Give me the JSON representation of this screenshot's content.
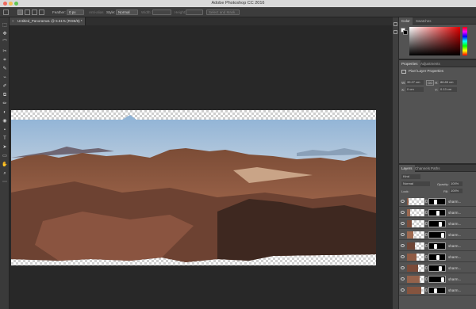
{
  "window": {
    "title": "Adobe Photoshop CC 2016"
  },
  "options_bar": {
    "feather_label": "Feather:",
    "feather_value": "0 px",
    "antialias_label": "Anti-alias",
    "style_label": "Style:",
    "style_value": "Normal",
    "width_label": "Width:",
    "height_label": "Height:",
    "select_mask_label": "Select and Mask..."
  },
  "document_tab": {
    "label": "Untitled_Panorama1 @ 5.61% (RGB/8) *",
    "close": "×"
  },
  "tools": [
    "⬚",
    "✥",
    "⌒",
    "✂",
    "⌗",
    "✎",
    "⌁",
    "✐",
    "⧉",
    "✏",
    "◐",
    "◉",
    "⬩",
    "T",
    "➤",
    "▭",
    "✋",
    "⌕",
    "⋯"
  ],
  "color_panel": {
    "tabs": [
      "Color",
      "Swatches"
    ],
    "colors": {
      "fg": "#ffffff",
      "bg": "#000000"
    }
  },
  "properties_panel": {
    "tabs": [
      "Properties",
      "Adjustments"
    ],
    "title": "Pixel Layer Properties",
    "w_label": "W:",
    "w_value": "39.27 cm",
    "go_label": "GO",
    "h_label": "H:",
    "h_value": "86.89 cm",
    "x_label": "X:",
    "x_value": "0 cm",
    "y_label": "Y:",
    "y_value": "0.13 cm"
  },
  "layers_panel": {
    "tabs": [
      "Layers",
      "Channels",
      "Paths"
    ],
    "kind_label": "Kind",
    "blend_mode": "Normal",
    "opacity_label": "Opacity:",
    "opacity_value": "100%",
    "lock_label": "Lock:",
    "fill_label": "Fill:",
    "fill_value": "100%",
    "layers": [
      {
        "name": "sharm..."
      },
      {
        "name": "sharm..."
      },
      {
        "name": "sharm..."
      },
      {
        "name": "sharm..."
      },
      {
        "name": "sharm..."
      },
      {
        "name": "sharm..."
      },
      {
        "name": "sharm..."
      },
      {
        "name": "sharm..."
      },
      {
        "name": "sharm..."
      }
    ]
  }
}
